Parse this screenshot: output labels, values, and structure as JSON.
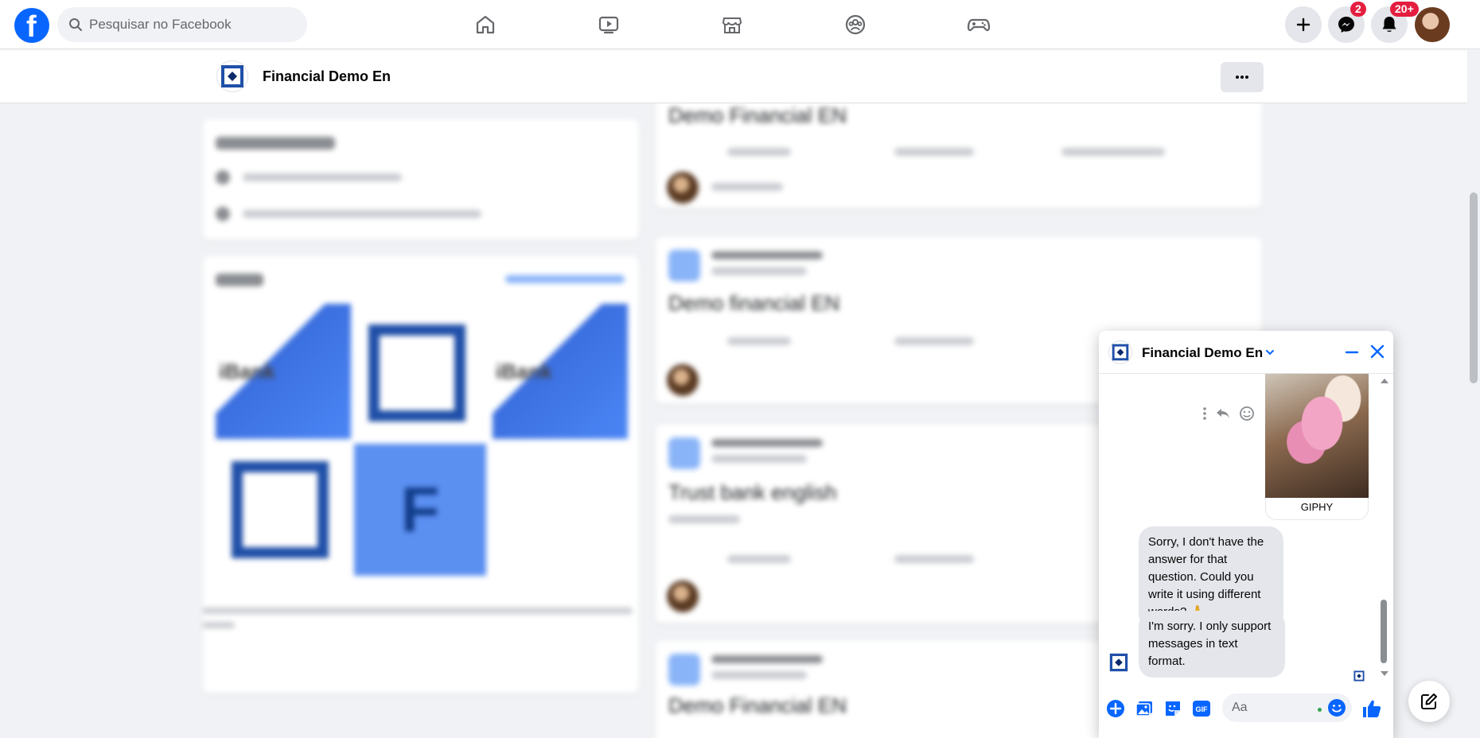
{
  "topnav": {
    "search_placeholder": "Pesquisar no Facebook",
    "messenger_badge": "2",
    "notifications_badge": "20+",
    "accent": "#0866ff"
  },
  "page": {
    "name": "Financial Demo En"
  },
  "background": {
    "post_title_1": "Demo Financial EN",
    "post_title_2": "Demo financial EN",
    "post_title_3": "Trust bank english",
    "post_title_4": "Demo Financial EN",
    "photo_tile_letter": "F",
    "photo_tile_brand": "iBank"
  },
  "chat": {
    "title": "Financial Demo En",
    "giphy_label": "GIPHY",
    "messages": [
      "Sorry, I don't have the answer for that question. Could you write it using different words? 🙏",
      "I'm sorry. I only support messages in text format."
    ],
    "input_placeholder": "Aa"
  },
  "icons": {
    "home": "home-icon",
    "watch": "video-icon",
    "marketplace": "marketplace-icon",
    "groups": "groups-icon",
    "gaming": "gaming-icon",
    "create": "plus-icon",
    "messenger": "messenger-icon",
    "notifications": "bell-icon",
    "compose": "compose-icon"
  }
}
